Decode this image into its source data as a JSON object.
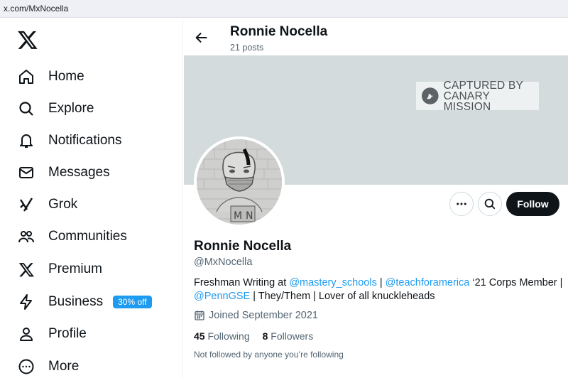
{
  "browser": {
    "url": "x.com/MxNocella"
  },
  "sidebar": {
    "logo_icon": "x-logo-icon",
    "items": [
      {
        "label": "Home",
        "icon": "home-icon"
      },
      {
        "label": "Explore",
        "icon": "search-icon"
      },
      {
        "label": "Notifications",
        "icon": "bell-icon"
      },
      {
        "label": "Messages",
        "icon": "envelope-icon"
      },
      {
        "label": "Grok",
        "icon": "grok-icon"
      },
      {
        "label": "Communities",
        "icon": "people-icon"
      },
      {
        "label": "Premium",
        "icon": "x-logo-icon"
      },
      {
        "label": "Business",
        "icon": "lightning-icon",
        "badge": "30% off"
      },
      {
        "label": "Profile",
        "icon": "person-icon"
      },
      {
        "label": "More",
        "icon": "more-circle-icon"
      }
    ]
  },
  "header": {
    "name": "Ronnie Nocella",
    "posts": "21 posts"
  },
  "banner": {
    "stamp_line1": "CAPTURED BY",
    "stamp_line2": "CANARY MISSION"
  },
  "profile": {
    "name": "Ronnie Nocella",
    "handle": "@MxNocella",
    "bio": {
      "p1": "Freshman Writing at ",
      "link1": "@mastery_schools",
      "p2": " | ",
      "link2": "@teachforamerica",
      "p3": " ‘21 Corps Member | ",
      "link3": "@PennGSE",
      "p4": " | They/Them | Lover of all knuckleheads"
    },
    "joined": "Joined September 2021",
    "following_count": "45",
    "following_label": "Following",
    "followers_count": "8",
    "followers_label": "Followers",
    "not_followed": "Not followed by anyone you’re following",
    "follow_label": "Follow"
  },
  "colors": {
    "accent": "#1d9bf0",
    "banner": "#d3dbdc",
    "text": "#0f1419",
    "muted": "#536471"
  }
}
